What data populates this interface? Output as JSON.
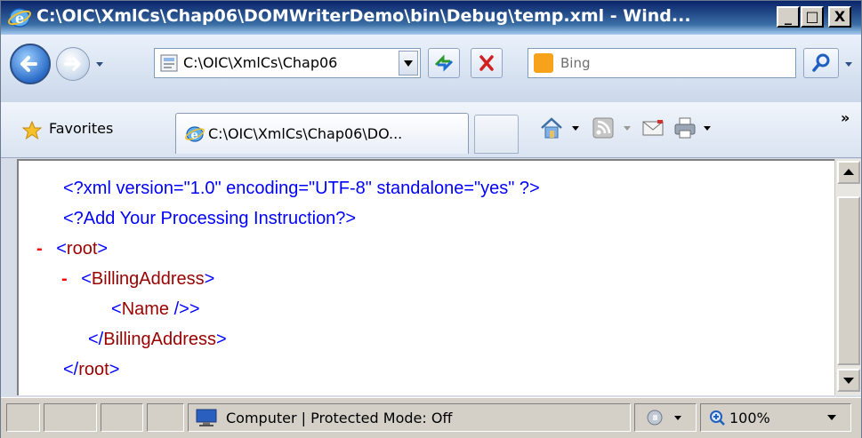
{
  "window": {
    "title": "C:\\OIC\\XmlCs\\Chap06\\DOMWriterDemo\\bin\\Debug\\temp.xml - Wind...",
    "min_glyph": "_",
    "max_glyph": "□",
    "close_glyph": "X"
  },
  "nav": {
    "address": "C:\\OIC\\XmlCs\\Chap06",
    "search_placeholder": "Bing"
  },
  "favorites": {
    "label": "Favorites",
    "tab_label": "C:\\OIC\\XmlCs\\Chap06\\DO...",
    "overflow": "»"
  },
  "xml": {
    "decl": "<?xml version=\"1.0\" encoding=\"UTF-8\" standalone=\"yes\" ?>",
    "pi": "<?Add Your Processing Instruction?>",
    "collapse": "-",
    "root_open_lt": "<",
    "root_name": "root",
    "gt": ">",
    "billing_name": "BillingAddress",
    "name_open_lt": "<",
    "name_name": "Name",
    "self_close": " />",
    "close_lt": "</",
    "root_close_name": "root"
  },
  "status": {
    "zone": "Computer | Protected Mode: Off",
    "zoom": "100%"
  },
  "colors": {
    "xml_markup": "#0000ff",
    "xml_element": "#990000",
    "collapse_marker": "#ff0000"
  }
}
